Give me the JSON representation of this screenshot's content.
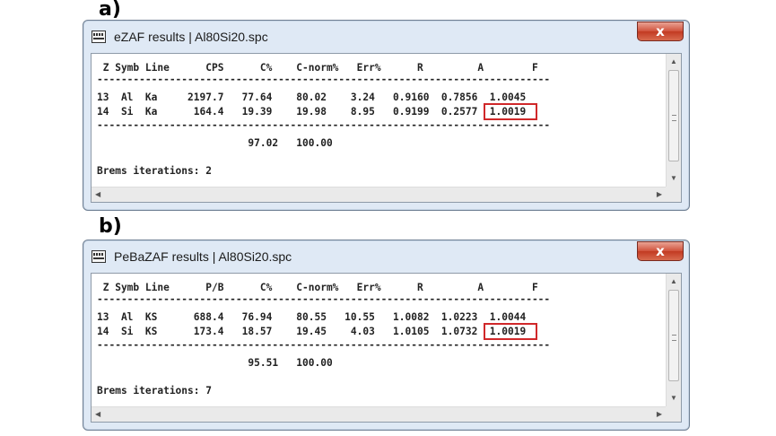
{
  "labels": {
    "a": "a)",
    "b": "b)"
  },
  "windows": [
    {
      "title": "eZAF results | Al80Si20.spc",
      "close": "x",
      "lines": [
        " Z Symb Line      CPS      C%    C-norm%   Err%      R         A        F",
        "---------------------------------------------------------------------------",
        "13  Al  Ka     2197.7   77.64    80.02    3.24   0.9160  0.7856  1.0045",
        "14  Si  Ka      164.4   19.39    19.98    8.95   0.9199  0.2577  1.0019",
        "---------------------------------------------------------------------------",
        "                         97.02   100.00",
        "Brems iterations: 2"
      ]
    },
    {
      "title": "PeBaZAF results | Al80Si20.spc",
      "close": "x",
      "lines": [
        " Z Symb Line      P/B      C%    C-norm%   Err%      R         A        F",
        "---------------------------------------------------------------------------",
        "13  Al  KS      688.4   76.94    80.55   10.55   1.0082  1.0223  1.0044",
        "14  Si  KS      173.4   18.57    19.45    4.03   1.0105  1.0732  1.0019",
        "---------------------------------------------------------------------------",
        "                         95.51   100.00",
        "Brems iterations: 7"
      ]
    }
  ],
  "colors": {
    "highlight": "#d0282a",
    "window_frame": "#dfe9f5",
    "close_button": "#c23a22"
  },
  "icons": [
    "app-icon",
    "close-icon",
    "scroll-up-icon",
    "scroll-down-icon",
    "scroll-left-icon",
    "scroll-right-icon",
    "resize-grip-icon"
  ]
}
